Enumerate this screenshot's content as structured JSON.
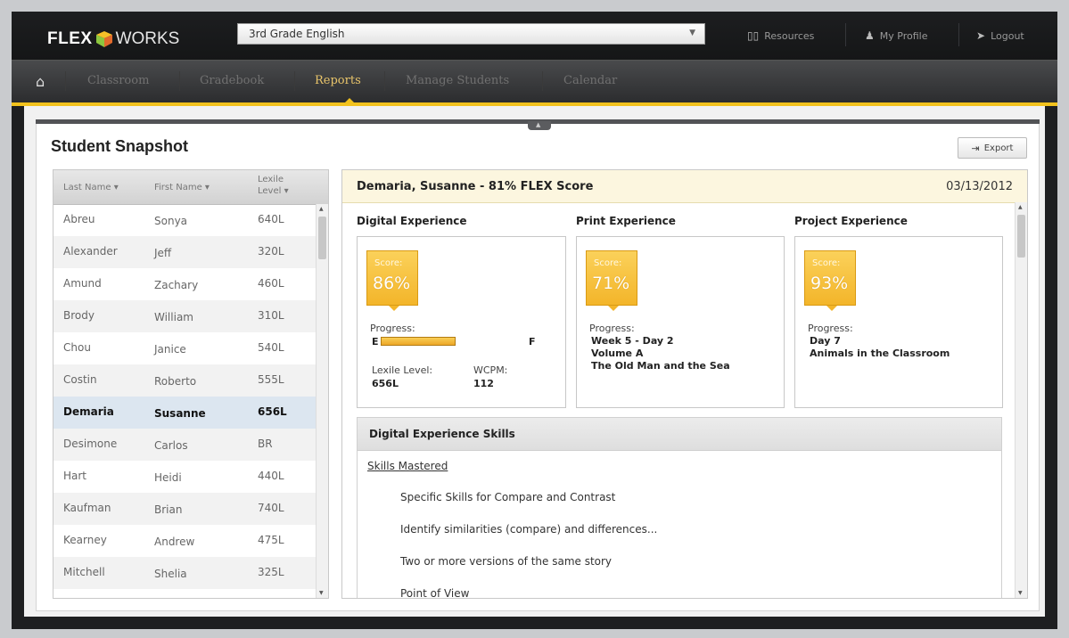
{
  "app": {
    "brand_left": "FLEX",
    "brand_right": "WORKS"
  },
  "course_select": {
    "value": "3rd Grade English"
  },
  "toplinks": {
    "resources": "Resources",
    "profile": "My Profile",
    "logout": "Logout"
  },
  "nav": {
    "items": [
      "Classroom",
      "Gradebook",
      "Reports",
      "Manage Students",
      "Calendar"
    ],
    "active": "Reports"
  },
  "page": {
    "title": "Student Snapshot",
    "export": "Export"
  },
  "student_table": {
    "headers": [
      "Last Name",
      "First Name",
      "Lexile Level"
    ],
    "rows": [
      [
        "Abreu",
        "Sonya",
        "640L"
      ],
      [
        "Alexander",
        "Jeff",
        "320L"
      ],
      [
        "Amund",
        "Zachary",
        "460L"
      ],
      [
        "Brody",
        "William",
        "310L"
      ],
      [
        "Chou",
        "Janice",
        "540L"
      ],
      [
        "Costin",
        "Roberto",
        "555L"
      ],
      [
        "Demaria",
        "Susanne",
        "656L"
      ],
      [
        "Desimone",
        "Carlos",
        "BR"
      ],
      [
        "Hart",
        "Heidi",
        "440L"
      ],
      [
        "Kaufman",
        "Brian",
        "740L"
      ],
      [
        "Kearney",
        "Andrew",
        "475L"
      ],
      [
        "Mitchell",
        "Shelia",
        "325L"
      ]
    ],
    "selected": "Demaria"
  },
  "detail": {
    "heading": "Demaria, Susanne - 81% FLEX Score",
    "date": "03/13/2012",
    "digital": {
      "title": "Digital Experience",
      "score_label": "Score:",
      "score": "86%",
      "progress_label": "Progress:",
      "progress_from": "E",
      "progress_to": "F",
      "progress_fraction": 0.55,
      "lexile_label": "Lexile Level:",
      "lexile": "656L",
      "wcpm_label": "WCPM:",
      "wcpm": "112"
    },
    "print": {
      "title": "Print Experience",
      "score_label": "Score:",
      "score": "71%",
      "progress_label": "Progress:",
      "line1": "Week 5 - Day 2",
      "line2": "Volume A",
      "line3": "The Old Man and the Sea"
    },
    "project": {
      "title": "Project Experience",
      "score_label": "Score:",
      "score": "93%",
      "progress_label": "Progress:",
      "line1": "Day 7",
      "line2": "Animals in the Classroom"
    },
    "skills": {
      "title": "Digital Experience Skills",
      "mastered_label": "Skills Mastered",
      "items": [
        "Specific Skills for Compare and Contrast",
        "Identify similarities (compare) and differences...",
        "Two or more versions of the same story",
        "Point of View"
      ]
    }
  },
  "colors": {
    "accent_yellow": "#f2c21d",
    "selected_row": "#dce6f0",
    "header_bg": "#fcf6df"
  }
}
